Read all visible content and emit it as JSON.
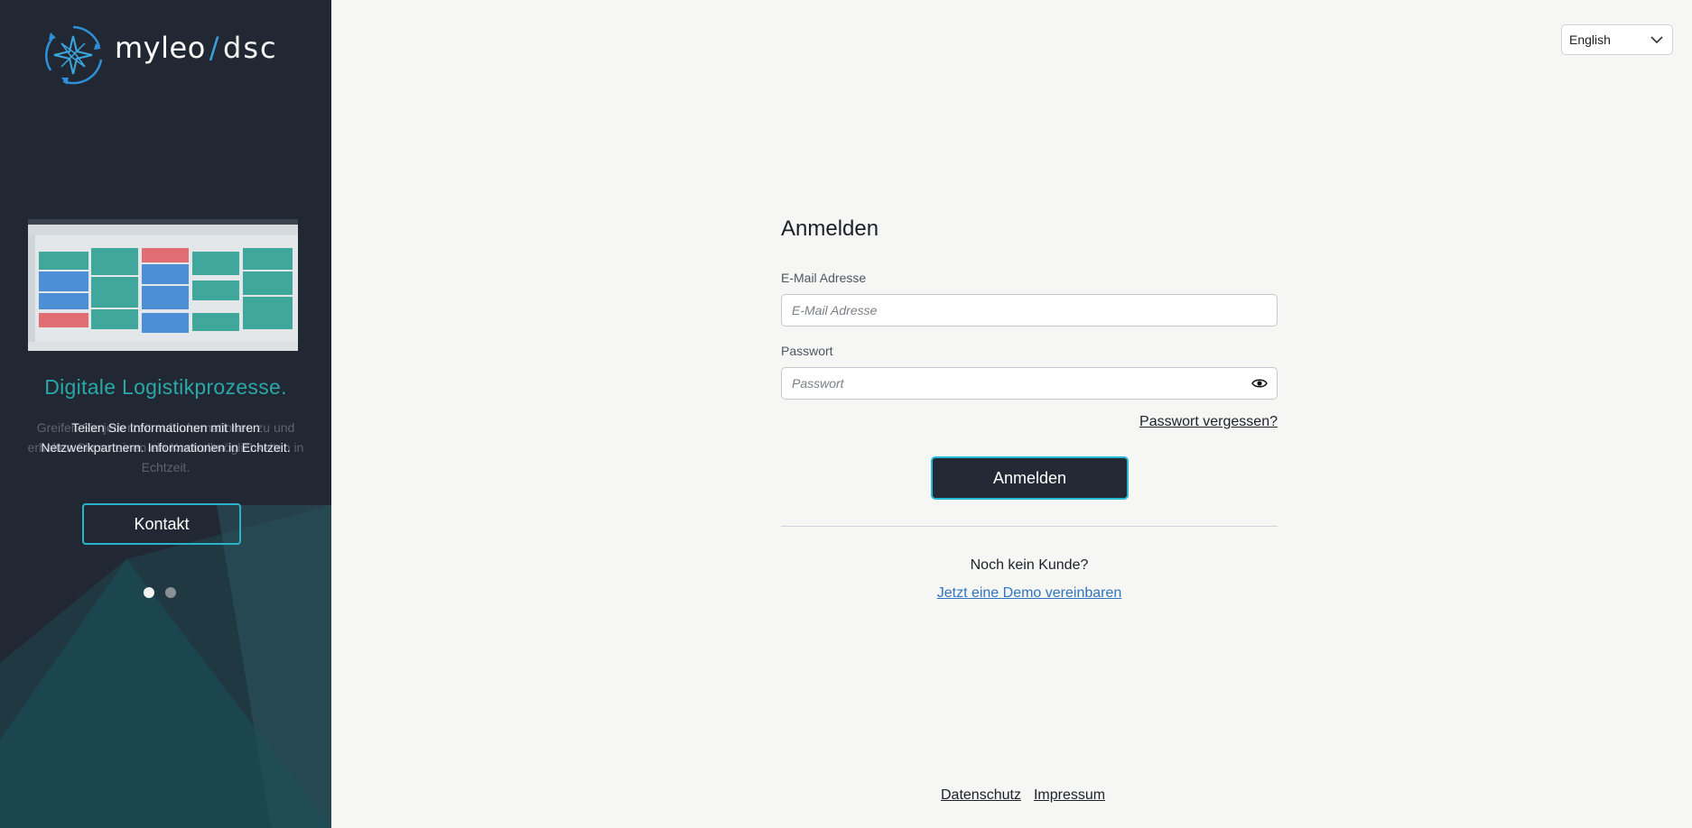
{
  "brand": {
    "name": "myleo",
    "product": "dsc"
  },
  "language_select": {
    "value": "English"
  },
  "slide": {
    "title": "Digitale Logistikprozesse.",
    "text": "Teilen Sie Informationen mit Ihren Netzwerkpartnern. Informationen in Echtzeit.",
    "ghost_text": "Greifen Sie jederzeit auf Informationen zu und erhalten Sie so einen ein Kontrollmöglichkeiten in Echtzeit.",
    "contact_label": "Kontakt"
  },
  "login": {
    "title": "Anmelden",
    "email_label": "E-Mail Adresse",
    "email_placeholder": "E-Mail Adresse",
    "password_label": "Passwort",
    "password_placeholder": "Passwort",
    "forgot_label": "Passwort vergessen?",
    "submit_label": "Anmelden",
    "no_customer": "Noch kein Kunde?",
    "demo_link": "Jetzt eine Demo vereinbaren"
  },
  "footer": {
    "privacy": "Datenschutz",
    "imprint": "Impressum"
  },
  "colors": {
    "sidebar_bg": "#222833",
    "accent": "#2bb3c7",
    "teal_title": "#2aa8a8",
    "link": "#2f74c0"
  },
  "icons": {
    "logo": "compass-star-logo-icon",
    "eye": "eye-icon",
    "chevron": "chevron-down-icon"
  }
}
